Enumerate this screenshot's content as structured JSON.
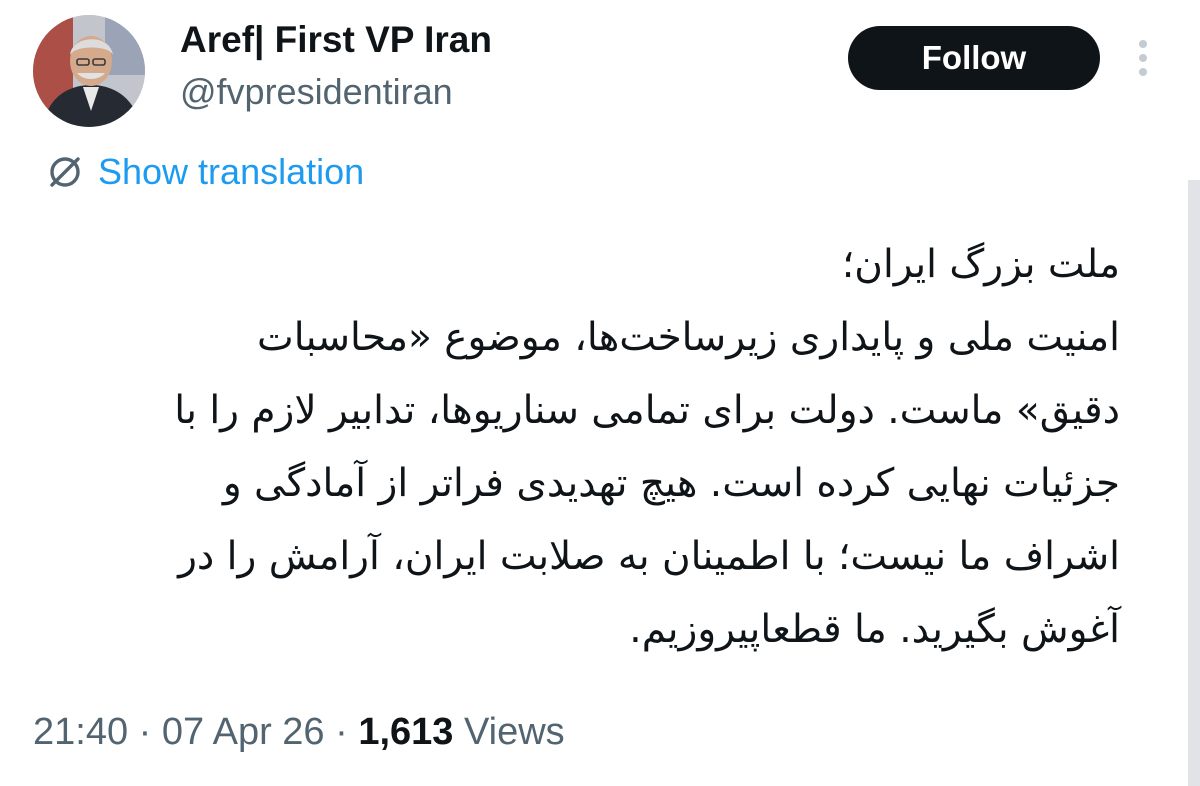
{
  "author": {
    "display_name": "Aref| First VP Iran",
    "handle": "@fvpresidentiran"
  },
  "actions": {
    "follow_label": "Follow",
    "more_icon": "more-vertical-icon"
  },
  "translation": {
    "icon": "globe-translate-icon",
    "label": "Show translation"
  },
  "tweet": {
    "lines": [
      "ملت بزرگ ایران؛",
      "امنیت ملی و پایداری زیرساخت‌ها، موضوع «محاسبات",
      "دقیق» ماست. دولت برای تمامی سناریوها، تدابیر لازم را با",
      "جزئیات نهایی کرده است. هیچ تهدیدی فراتر از آمادگی و",
      "اشراف ما نیست؛ با اطمینان به صلابت ایران، آرامش را در",
      "آغوش بگیرید. ما قطعاپیروزیم."
    ]
  },
  "meta": {
    "time": "21:40",
    "separator": "·",
    "date": "07 Apr 26",
    "views_count": "1,613",
    "views_label": "Views"
  },
  "colors": {
    "follow_bg": "#0f1419",
    "link": "#1d9bf0",
    "secondary_text": "#536471"
  }
}
